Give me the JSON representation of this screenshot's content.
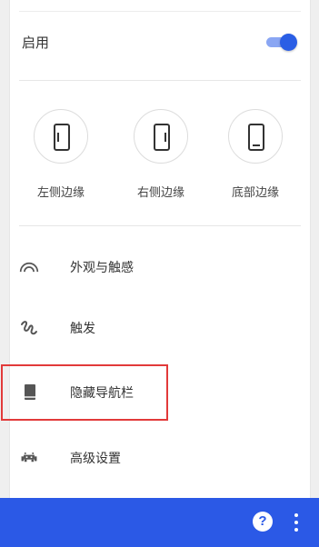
{
  "settings": {
    "enable_label": "启用",
    "enable_on": true
  },
  "edges": [
    {
      "label": "左侧边缘",
      "icon": "phone-left-edge-icon"
    },
    {
      "label": "右侧边缘",
      "icon": "phone-right-edge-icon"
    },
    {
      "label": "底部边缘",
      "icon": "phone-bottom-edge-icon"
    }
  ],
  "menu": [
    {
      "label": "外观与触感",
      "icon": "rainbow-icon"
    },
    {
      "label": "触发",
      "icon": "gesture-icon"
    },
    {
      "label": "隐藏导航栏",
      "icon": "book-icon"
    },
    {
      "label": "高级设置",
      "icon": "invader-icon"
    }
  ],
  "bottom_bar": {
    "help_label": "?",
    "accent_color": "#2b59e6"
  }
}
